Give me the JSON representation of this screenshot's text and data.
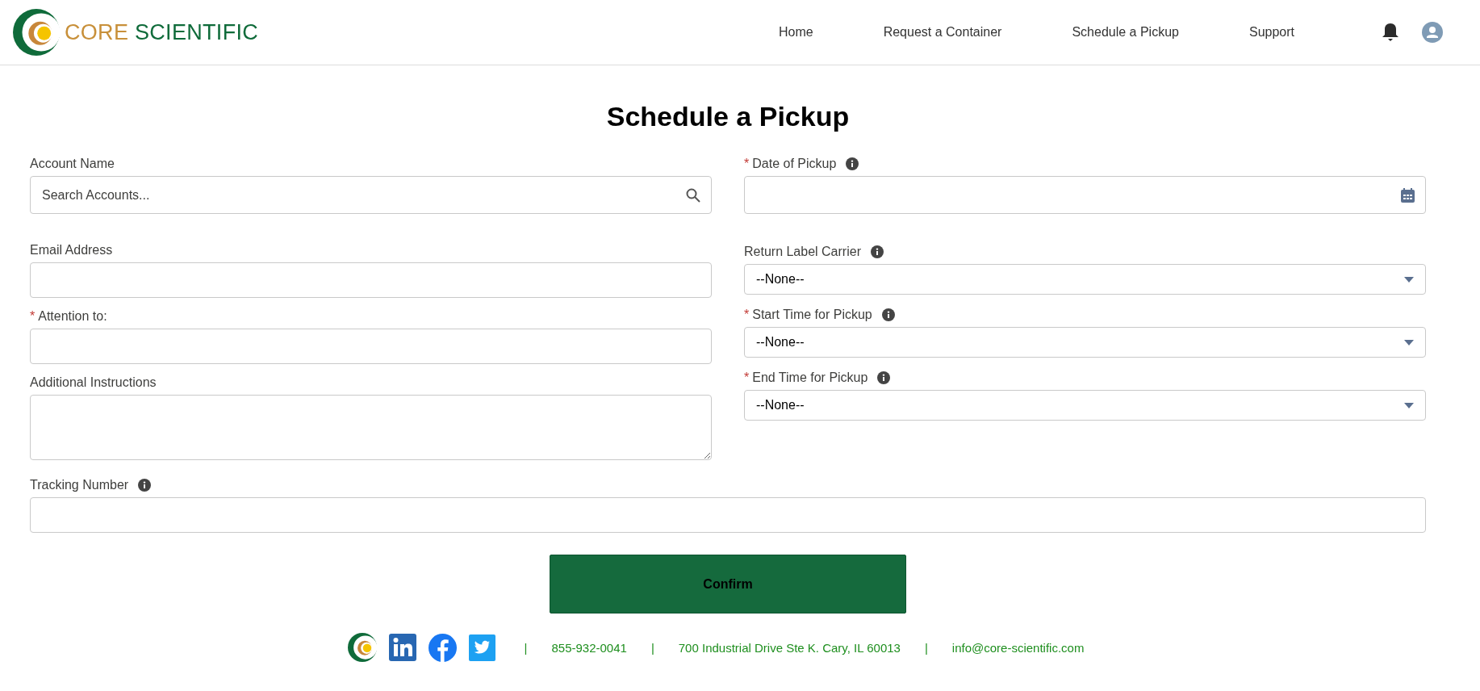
{
  "header": {
    "brand": "CORE SCIENTIFIC",
    "nav": [
      "Home",
      "Request a Container",
      "Schedule a Pickup",
      "Support"
    ]
  },
  "title": "Schedule a Pickup",
  "left_fields": [
    {
      "kind": "search",
      "label": "Account Name",
      "placeholder": "Search Accounts..."
    },
    {
      "kind": "text",
      "label": "Email Address"
    },
    {
      "kind": "text",
      "label": "Attention to:",
      "required_mark": "*"
    },
    {
      "kind": "textarea",
      "label": "Additional Instructions"
    }
  ],
  "right_fields": [
    {
      "kind": "date",
      "label": "Date of Pickup",
      "required_mark": "*",
      "info": true
    },
    {
      "kind": "select",
      "label": "Return Label Carrier",
      "info": true,
      "value": "--None--"
    },
    {
      "kind": "select",
      "label": "Start Time for Pickup",
      "required_mark": "*",
      "info": true,
      "value": "--None--"
    },
    {
      "kind": "select",
      "label": "End Time for Pickup",
      "required_mark": "*",
      "info": true,
      "value": "--None--"
    }
  ],
  "tracking_field": {
    "kind": "text",
    "label": "Tracking Number",
    "info": true
  },
  "confirm_button": "Confirm",
  "footer": {
    "contacts": [
      {
        "separator": "|",
        "text": "855-932-0041"
      },
      {
        "separator": "|",
        "text": "700 Industrial Drive Ste K. Cary, IL 60013"
      },
      {
        "separator": "|",
        "text": "info@core-scientific.com"
      }
    ]
  }
}
